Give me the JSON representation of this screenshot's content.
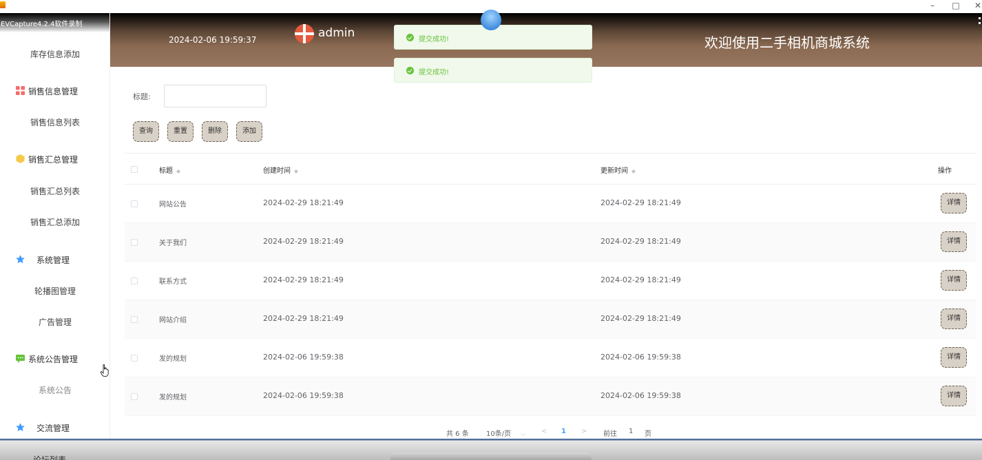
{
  "window": {
    "minimize": "–",
    "maximize": "□",
    "close": "✕"
  },
  "recorder": {
    "label": "EVCapture4.2.4软件录制"
  },
  "sidebar": {
    "items": [
      {
        "type": "sub",
        "label": "库存信息添加"
      },
      {
        "type": "group",
        "label": "销售信息管理",
        "icon": "grid-icon",
        "icon_color": "#f56c6c"
      },
      {
        "type": "sub",
        "label": "销售信息列表"
      },
      {
        "type": "group",
        "label": "销售汇总管理",
        "icon": "hexagon-icon",
        "icon_color": "#f7c948"
      },
      {
        "type": "sub",
        "label": "销售汇总列表"
      },
      {
        "type": "sub",
        "label": "销售汇总添加"
      },
      {
        "type": "group",
        "label": "系统管理",
        "icon": "star-icon",
        "icon_color": "#409eff"
      },
      {
        "type": "sub",
        "label": "轮播图管理"
      },
      {
        "type": "sub",
        "label": "广告管理"
      },
      {
        "type": "group",
        "label": "系统公告管理",
        "icon": "message-icon",
        "icon_color": "#67c23a"
      },
      {
        "type": "sub",
        "label": "系统公告"
      },
      {
        "type": "group",
        "label": "交流管理",
        "icon": "star-icon",
        "icon_color": "#409eff"
      },
      {
        "type": "sub",
        "label": "论坛列表"
      }
    ]
  },
  "header": {
    "datetime": "2024-02-06 19:59:37",
    "username": "admin",
    "site_title": "欢迎使用二手相机商城系统"
  },
  "toasts": [
    {
      "text": "提交成功!"
    },
    {
      "text": "提交成功!"
    }
  ],
  "filter": {
    "title_label": "标题:",
    "title_value": "",
    "buttons": {
      "search": "查询",
      "reset": "重置",
      "delete": "删除",
      "add": "添加"
    }
  },
  "table": {
    "columns": {
      "title": "标题",
      "created": "创建时间",
      "updated": "更新时间",
      "actions": "操作"
    },
    "detail_label": "详情",
    "rows": [
      {
        "title": "网站公告",
        "created": "2024-02-29 18:21:49",
        "updated": "2024-02-29 18:21:49"
      },
      {
        "title": "关于我们",
        "created": "2024-02-29 18:21:49",
        "updated": "2024-02-29 18:21:49"
      },
      {
        "title": "联系方式",
        "created": "2024-02-29 18:21:49",
        "updated": "2024-02-29 18:21:49"
      },
      {
        "title": "网站介绍",
        "created": "2024-02-29 18:21:49",
        "updated": "2024-02-29 18:21:49"
      },
      {
        "title": "发的规划",
        "created": "2024-02-06 19:59:38",
        "updated": "2024-02-06 19:59:38"
      },
      {
        "title": "发的规划",
        "created": "2024-02-06 19:59:38",
        "updated": "2024-02-06 19:59:38"
      }
    ]
  },
  "pagination": {
    "total": "共 6 条",
    "page_size": "10条/页",
    "prev": "<",
    "current": "1",
    "next": ">",
    "goto_prefix": "前往",
    "goto_value": "1",
    "goto_suffix": "页"
  }
}
